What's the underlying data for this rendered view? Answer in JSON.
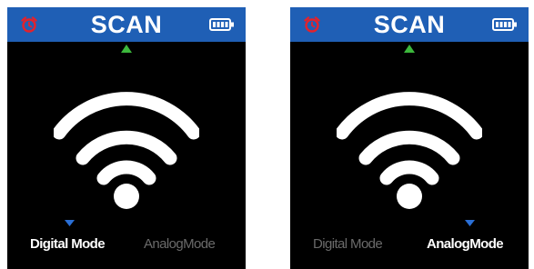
{
  "screens": [
    {
      "title": "SCAN",
      "modes": {
        "digital_label": "Digital Mode",
        "analog_label": "AnalogMode",
        "selected": "digital"
      },
      "icons": {
        "status_left": "alarm-clock-icon",
        "status_right": "battery-icon",
        "nav_up": "up-arrow-icon",
        "main": "wifi-signal-icon",
        "mode_indicator": "down-arrow-icon"
      }
    },
    {
      "title": "SCAN",
      "modes": {
        "digital_label": "Digital Mode",
        "analog_label": "AnalogMode",
        "selected": "analog"
      },
      "icons": {
        "status_left": "alarm-clock-icon",
        "status_right": "battery-icon",
        "nav_up": "up-arrow-icon",
        "main": "wifi-signal-icon",
        "mode_indicator": "down-arrow-icon"
      }
    }
  ],
  "colors": {
    "status_bar": "#1f5fb5",
    "alarm_icon": "#e3222c",
    "nav_arrow": "#3cb83c",
    "mode_cursor": "#2a6fd6",
    "active_text": "#ffffff",
    "inactive_text": "#6a6a6a",
    "screen_background": "#000000"
  }
}
